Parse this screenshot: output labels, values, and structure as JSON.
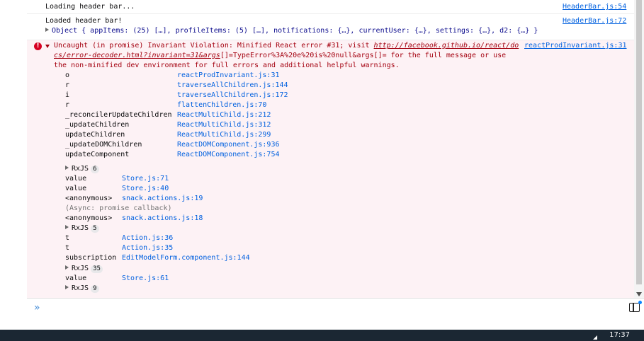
{
  "messages": [
    {
      "text": "Loading header bar...",
      "source": "HeaderBar.js:54"
    },
    {
      "text": "Loaded header bar!",
      "source": "HeaderBar.js:72",
      "object": "Object { appItems: (25) […], profileItems: (5) […], notifications: {…}, currentUser: {…}, settings: {…}, d2: {…} }"
    }
  ],
  "error": {
    "line1_prefix": "Uncaught (in promise) Invariant Violation: Minified React error #31; visit ",
    "link_part1": "http://facebook.github.io/react/do",
    "link_part2": "cs/error-decoder.html?invariant=31&args",
    "line2_suffix": "[]=TypeError%3A%20e%20is%20null&args[]= for the full message or use",
    "line3": "the non-minified dev environment for full errors and additional helpful warnings.",
    "source": "reactProdInvariant.js:31",
    "stack": [
      {
        "fn": "o",
        "loc": "reactProdInvariant.js:31"
      },
      {
        "fn": "r",
        "loc": "traverseAllChildren.js:144"
      },
      {
        "fn": "i",
        "loc": "traverseAllChildren.js:172"
      },
      {
        "fn": "r",
        "loc": "flattenChildren.js:70"
      },
      {
        "fn": "_reconcilerUpdateChildren",
        "loc": "ReactMultiChild.js:212"
      },
      {
        "fn": "_updateChildren",
        "loc": "ReactMultiChild.js:312"
      },
      {
        "fn": "updateChildren",
        "loc": "ReactMultiChild.js:299"
      },
      {
        "fn": "_updateDOMChildren",
        "loc": "ReactDOMComponent.js:936"
      },
      {
        "fn": "updateComponent",
        "loc": "ReactDOMComponent.js:754"
      }
    ],
    "group1": {
      "label": "RxJS",
      "count": "6"
    },
    "stack2": [
      {
        "fn": "value",
        "loc": "Store.js:71"
      },
      {
        "fn": "value",
        "loc": "Store.js:40"
      },
      {
        "fn": "<anonymous>",
        "loc": "snack.actions.js:19"
      }
    ],
    "async_label": "(Async: promise callback)",
    "stack3": [
      {
        "fn": "<anonymous>",
        "loc": "snack.actions.js:18"
      }
    ],
    "group2": {
      "label": "RxJS",
      "count": "5"
    },
    "stack4": [
      {
        "fn": "t",
        "loc": "Action.js:36"
      },
      {
        "fn": "t",
        "loc": "Action.js:35"
      },
      {
        "fn": "subscription",
        "loc": "EditModelForm.component.js:144"
      }
    ],
    "group3": {
      "label": "RxJS",
      "count": "35"
    },
    "stack5": [
      {
        "fn": "value",
        "loc": "Store.js:61"
      }
    ],
    "group4": {
      "label": "RxJS",
      "count": "9"
    }
  },
  "input": {
    "prompt": "»"
  },
  "taskbar": {
    "clock": "17:37"
  }
}
